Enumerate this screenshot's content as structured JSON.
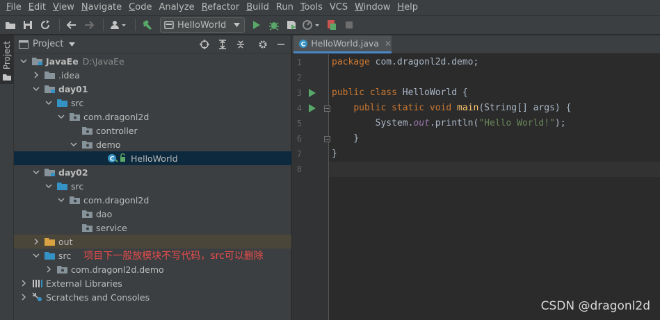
{
  "menu": [
    {
      "underline": "F",
      "rest": "ile"
    },
    {
      "underline": "E",
      "rest": "dit"
    },
    {
      "underline": "V",
      "rest": "iew"
    },
    {
      "underline": "N",
      "rest": "avigate"
    },
    {
      "underline": "C",
      "rest": "ode"
    },
    {
      "underline": "",
      "rest": "Analyze"
    },
    {
      "underline": "R",
      "rest": "efactor"
    },
    {
      "underline": "B",
      "rest": "uild"
    },
    {
      "underline": "",
      "rest": "Run"
    },
    {
      "underline": "T",
      "rest": "ools"
    },
    {
      "underline": "",
      "rest": "VCS"
    },
    {
      "underline": "W",
      "rest": "indow"
    },
    {
      "underline": "H",
      "rest": "elp"
    }
  ],
  "toolbar": {
    "run_config": "HelloWorld",
    "icons": [
      "open-folder-icon",
      "save-icon",
      "sync-icon",
      "back-arrow-icon",
      "forward-arrow-icon",
      "user-icon",
      "hammer-icon",
      "run-icon",
      "debug-icon",
      "coverage-icon",
      "profile-icon",
      "gradle-icon",
      "stop-icon"
    ]
  },
  "left_strip": {
    "tab": "Project"
  },
  "project": {
    "header": "Project",
    "tree": [
      {
        "name": "JavaEe",
        "path": "D:\\JavaEe",
        "bold": true,
        "indent": 0,
        "arrow": "down",
        "icon": "module"
      },
      {
        "name": ".idea",
        "indent": 1,
        "arrow": "right",
        "icon": "folder"
      },
      {
        "name": "day01",
        "bold": true,
        "indent": 1,
        "arrow": "down",
        "icon": "module"
      },
      {
        "name": "src",
        "indent": 2,
        "arrow": "down",
        "icon": "src"
      },
      {
        "name": "com.dragonl2d",
        "indent": 3,
        "arrow": "down",
        "icon": "package"
      },
      {
        "name": "controller",
        "indent": 4,
        "arrow": "",
        "icon": "package"
      },
      {
        "name": "demo",
        "indent": 4,
        "arrow": "down",
        "icon": "package"
      },
      {
        "name": "HelloWorld",
        "indent": 6,
        "arrow": "",
        "icon": "class",
        "selected": true
      },
      {
        "name": "day02",
        "bold": true,
        "indent": 1,
        "arrow": "down",
        "icon": "module"
      },
      {
        "name": "src",
        "indent": 2,
        "arrow": "down",
        "icon": "src"
      },
      {
        "name": "com.dragonl2d",
        "indent": 3,
        "arrow": "down",
        "icon": "package"
      },
      {
        "name": "dao",
        "indent": 4,
        "arrow": "",
        "icon": "package"
      },
      {
        "name": "service",
        "indent": 4,
        "arrow": "",
        "icon": "package"
      },
      {
        "name": "out",
        "indent": 1,
        "arrow": "right",
        "icon": "out",
        "excluded": true
      },
      {
        "name": "src",
        "indent": 1,
        "arrow": "down",
        "icon": "src",
        "annotation": "项目下一般放模块不写代码，src可以删除"
      },
      {
        "name": "com.dragonl2d.demo",
        "indent": 2,
        "arrow": "right",
        "icon": "package"
      },
      {
        "name": "External Libraries",
        "indent": 0,
        "arrow": "right",
        "icon": "libraries"
      },
      {
        "name": "Scratches and Consoles",
        "indent": 0,
        "arrow": "right",
        "icon": "scratches"
      }
    ]
  },
  "editor": {
    "tab": "HelloWorld.java",
    "lines": [
      {
        "n": "1",
        "parts": [
          [
            "kw",
            "package "
          ],
          [
            "",
            "com.dragonl2d.demo;"
          ]
        ]
      },
      {
        "n": "2",
        "parts": []
      },
      {
        "n": "3",
        "parts": [
          [
            "kw",
            "public class "
          ],
          [
            "",
            "HelloWorld {"
          ]
        ],
        "run": true
      },
      {
        "n": "4",
        "parts": [
          [
            "",
            "    "
          ],
          [
            "kw",
            "public static void "
          ],
          [
            "fn",
            "main"
          ],
          [
            "",
            "(String[] args) {"
          ]
        ],
        "run": true,
        "fold": true
      },
      {
        "n": "5",
        "parts": [
          [
            "",
            "        System."
          ],
          [
            "it",
            "out"
          ],
          [
            "",
            ".println("
          ],
          [
            "st",
            "\"Hello World!\""
          ],
          [
            "",
            ");"
          ]
        ]
      },
      {
        "n": "6",
        "parts": [
          [
            "",
            "    }"
          ]
        ],
        "fold": true
      },
      {
        "n": "7",
        "parts": [
          [
            "",
            "}"
          ]
        ]
      },
      {
        "n": "8",
        "parts": [],
        "current": true
      }
    ]
  },
  "watermark": "CSDN @dragonl2d"
}
